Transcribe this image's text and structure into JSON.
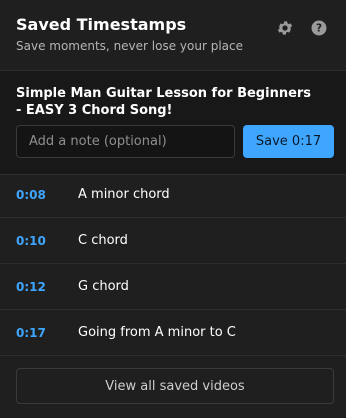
{
  "header": {
    "title": "Saved Timestamps",
    "subtitle": "Save moments, never lose your place",
    "icons": [
      "gear-icon",
      "help-icon"
    ]
  },
  "video": {
    "title": "Simple Man Guitar Lesson for Beginners - EASY 3 Chord Song!",
    "note_placeholder": "Add a note (optional)",
    "save_label": "Save 0:17"
  },
  "timestamps": [
    {
      "time": "0:08",
      "label": "A minor chord"
    },
    {
      "time": "0:10",
      "label": "C chord"
    },
    {
      "time": "0:12",
      "label": "G chord"
    },
    {
      "time": "0:17",
      "label": "Going from A minor to C"
    }
  ],
  "footer": {
    "view_all_label": "View all saved videos"
  },
  "colors": {
    "accent": "#3ea6ff",
    "background": "#1f1f1f",
    "panel": "#181818"
  }
}
